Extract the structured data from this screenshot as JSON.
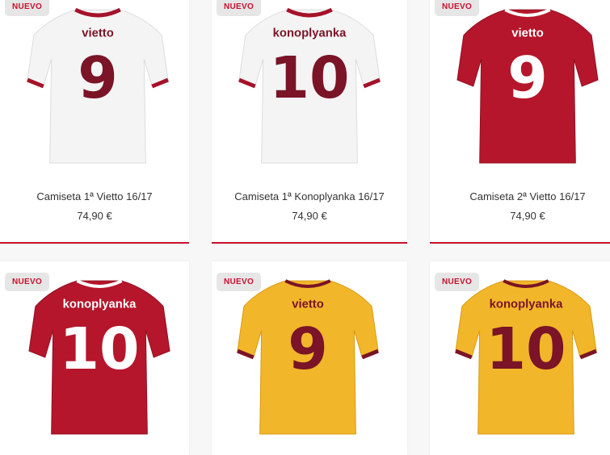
{
  "colors": {
    "accent": "#c8102e",
    "maroon": "#7a1426",
    "white_kit": "#f4f4f4",
    "red_kit": "#b5162b",
    "yellow_kit": "#f2b62a"
  },
  "products": [
    {
      "badge": "NUEVO",
      "name": "vietto",
      "number": "9",
      "kit": "white",
      "title": "Camiseta 1ª Vietto 16/17",
      "price": "74,90 €"
    },
    {
      "badge": "NUEVO",
      "name": "konoplyanka",
      "number": "10",
      "kit": "white",
      "title": "Camiseta 1ª Konoplyanka 16/17",
      "price": "74,90 €"
    },
    {
      "badge": "NUEVO",
      "name": "vietto",
      "number": "9",
      "kit": "red",
      "title": "Camiseta 2ª Vietto 16/17",
      "price": "74,90 €"
    },
    {
      "badge": "NUEVO",
      "name": "konoplyanka",
      "number": "10",
      "kit": "red"
    },
    {
      "badge": "NUEVO",
      "name": "vietto",
      "number": "9",
      "kit": "yellow"
    },
    {
      "badge": "NUEVO",
      "name": "konoplyanka",
      "number": "10",
      "kit": "yellow"
    }
  ]
}
